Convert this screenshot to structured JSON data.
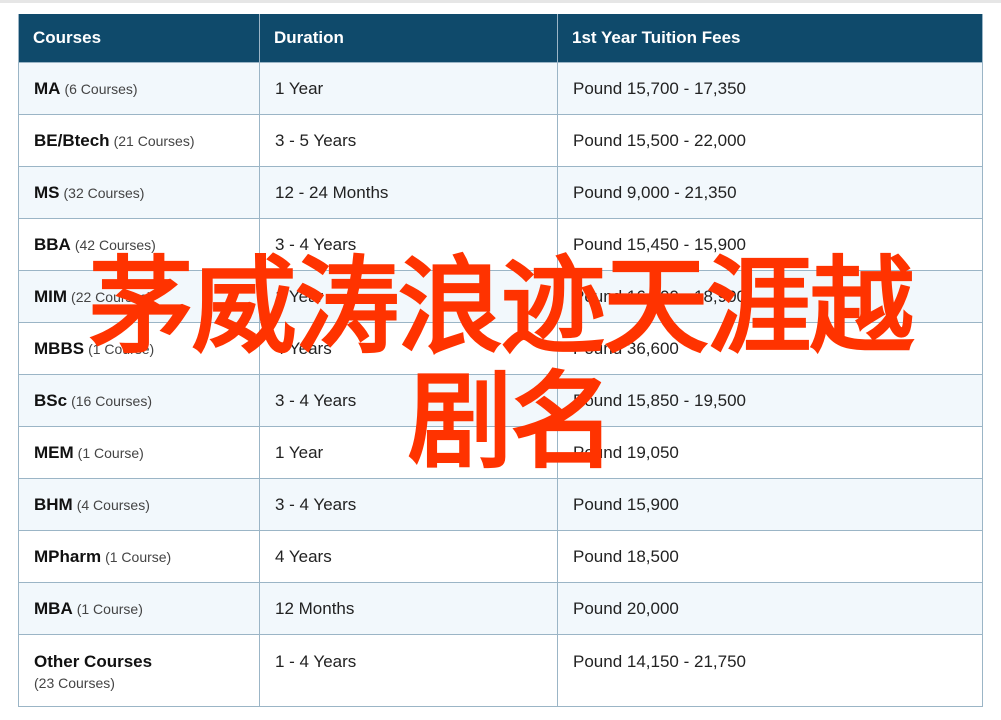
{
  "table": {
    "headers": [
      "Courses",
      "Duration",
      "1st Year Tuition Fees"
    ],
    "rows": [
      {
        "name": "MA",
        "count": "(6 Courses)",
        "duration": "1 Year",
        "fee": "Pound 15,700 - 17,350"
      },
      {
        "name": "BE/Btech",
        "count": "(21 Courses)",
        "duration": "3 - 5 Years",
        "fee": "Pound 15,500 - 22,000"
      },
      {
        "name": "MS",
        "count": "(32 Courses)",
        "duration": "12 - 24 Months",
        "fee": "Pound 9,000 - 21,350"
      },
      {
        "name": "BBA",
        "count": "(42 Courses)",
        "duration": "3 - 4 Years",
        "fee": "Pound 15,450 - 15,900"
      },
      {
        "name": "MIM",
        "count": "(22 Courses)",
        "duration": "1 Year",
        "fee": "Pound 16,400 - 18,900"
      },
      {
        "name": "MBBS",
        "count": "(1 Course)",
        "duration": "4 Years",
        "fee": "Pound 36,600"
      },
      {
        "name": "BSc",
        "count": "(16 Courses)",
        "duration": "3 - 4 Years",
        "fee": "Pound 15,850 - 19,500"
      },
      {
        "name": "MEM",
        "count": "(1 Course)",
        "duration": "1 Year",
        "fee": "Pound 19,050"
      },
      {
        "name": "BHM",
        "count": "(4 Courses)",
        "duration": "3 - 4 Years",
        "fee": "Pound 15,900"
      },
      {
        "name": "MPharm",
        "count": "(1 Course)",
        "duration": "4 Years",
        "fee": "Pound 18,500"
      },
      {
        "name": "MBA",
        "count": "(1 Course)",
        "duration": "12 Months",
        "fee": "Pound 20,000"
      },
      {
        "name": "Other Courses",
        "count": "(23 Courses)",
        "duration": "1 - 4 Years",
        "fee": "Pound 14,150 - 21,750"
      }
    ]
  },
  "overlay": {
    "line1": "茅威涛浪迹天涯越",
    "line2": "剧名",
    "color": "#ff3300"
  },
  "colors": {
    "header_bg": "#0f4a6b",
    "row_alt_bg": "#f2f8fc",
    "border": "#9bb5c6"
  }
}
